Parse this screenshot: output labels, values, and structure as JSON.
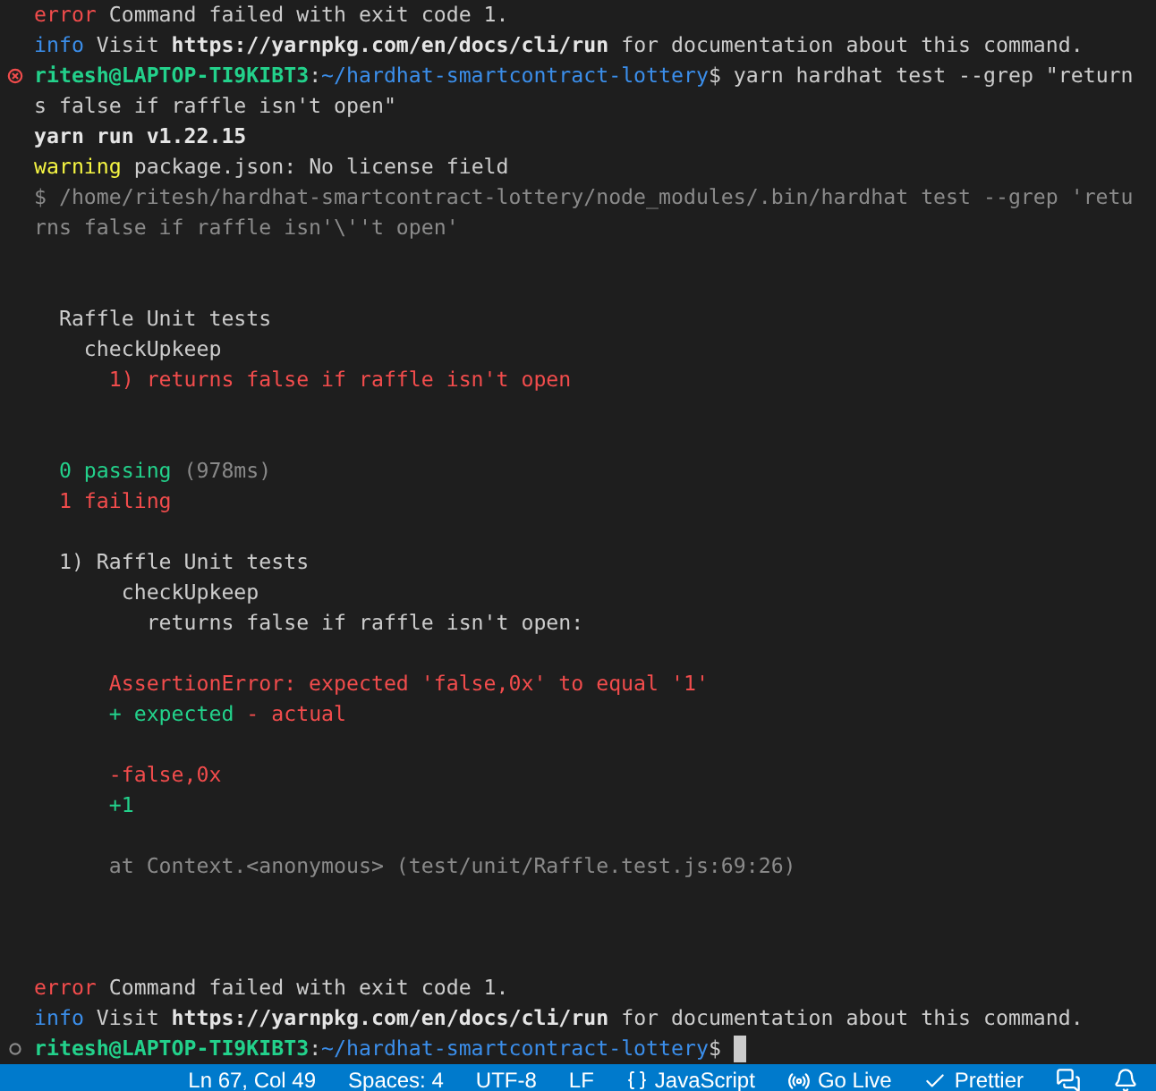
{
  "terminal": {
    "lines": [
      {
        "kind": "output",
        "segments": [
          {
            "kind": "error",
            "text": "error"
          },
          {
            "kind": "plain",
            "text": " Command failed with exit code 1."
          }
        ]
      },
      {
        "kind": "output",
        "segments": [
          {
            "kind": "info",
            "text": "info"
          },
          {
            "kind": "plain",
            "text": " Visit "
          },
          {
            "kind": "bold",
            "text": "https://yarnpkg.com/en/docs/cli/run"
          },
          {
            "kind": "plain",
            "text": " for documentation about this command."
          }
        ]
      },
      {
        "kind": "prompt",
        "failed": true,
        "cursor": false,
        "segments": [
          {
            "kind": "user",
            "text": "ritesh@LAPTOP-TI9KIBT3"
          },
          {
            "kind": "plain",
            "text": ":"
          },
          {
            "kind": "path",
            "text": "~/hardhat-smartcontract-lottery"
          },
          {
            "kind": "plain",
            "text": "$ yarn hardhat test --grep \"return"
          }
        ]
      },
      {
        "kind": "output",
        "segments": [
          {
            "kind": "plain",
            "text": "s false if raffle isn't open\""
          }
        ]
      },
      {
        "kind": "output",
        "segments": [
          {
            "kind": "bold",
            "text": "yarn run v1.22.15"
          }
        ]
      },
      {
        "kind": "output",
        "segments": [
          {
            "kind": "warning",
            "text": "warning"
          },
          {
            "kind": "plain",
            "text": " package.json: No license field"
          }
        ]
      },
      {
        "kind": "output",
        "segments": [
          {
            "kind": "dim",
            "text": "$ /home/ritesh/hardhat-smartcontract-lottery/node_modules/.bin/hardhat test --grep 'retu"
          }
        ]
      },
      {
        "kind": "output",
        "segments": [
          {
            "kind": "dim",
            "text": "rns false if raffle isn'\\''t open'"
          }
        ]
      },
      {
        "kind": "blank"
      },
      {
        "kind": "blank"
      },
      {
        "kind": "output",
        "segments": [
          {
            "kind": "plain",
            "text": "  Raffle Unit tests"
          }
        ]
      },
      {
        "kind": "output",
        "segments": [
          {
            "kind": "plain",
            "text": "    checkUpkeep"
          }
        ]
      },
      {
        "kind": "output",
        "segments": [
          {
            "kind": "red",
            "text": "      1) returns false if raffle isn't open"
          }
        ]
      },
      {
        "kind": "blank"
      },
      {
        "kind": "blank"
      },
      {
        "kind": "output",
        "segments": [
          {
            "kind": "green",
            "text": "  0 passing"
          },
          {
            "kind": "dim",
            "text": " (978ms)"
          }
        ]
      },
      {
        "kind": "output",
        "segments": [
          {
            "kind": "red",
            "text": "  1 failing"
          }
        ]
      },
      {
        "kind": "blank"
      },
      {
        "kind": "output",
        "segments": [
          {
            "kind": "plain",
            "text": "  1) Raffle Unit tests"
          }
        ]
      },
      {
        "kind": "output",
        "segments": [
          {
            "kind": "plain",
            "text": "       checkUpkeep"
          }
        ]
      },
      {
        "kind": "output",
        "segments": [
          {
            "kind": "plain",
            "text": "         returns false if raffle isn't open:"
          }
        ]
      },
      {
        "kind": "blank"
      },
      {
        "kind": "output",
        "segments": [
          {
            "kind": "red",
            "text": "      AssertionError: expected 'false,0x' to equal '1'"
          }
        ]
      },
      {
        "kind": "output",
        "segments": [
          {
            "kind": "green",
            "text": "      + expected "
          },
          {
            "kind": "red",
            "text": "- actual"
          }
        ]
      },
      {
        "kind": "blank"
      },
      {
        "kind": "output",
        "segments": [
          {
            "kind": "red",
            "text": "      -false,0x"
          }
        ]
      },
      {
        "kind": "output",
        "segments": [
          {
            "kind": "green",
            "text": "      +1"
          }
        ]
      },
      {
        "kind": "blank"
      },
      {
        "kind": "output",
        "segments": [
          {
            "kind": "dim",
            "text": "      at Context.<anonymous> (test/unit/Raffle.test.js:69:26)"
          }
        ]
      },
      {
        "kind": "blank"
      },
      {
        "kind": "blank"
      },
      {
        "kind": "blank"
      },
      {
        "kind": "output",
        "segments": [
          {
            "kind": "error",
            "text": "error"
          },
          {
            "kind": "plain",
            "text": " Command failed with exit code 1."
          }
        ]
      },
      {
        "kind": "output",
        "segments": [
          {
            "kind": "info",
            "text": "info"
          },
          {
            "kind": "plain",
            "text": " Visit "
          },
          {
            "kind": "bold",
            "text": "https://yarnpkg.com/en/docs/cli/run"
          },
          {
            "kind": "plain",
            "text": " for documentation about this command."
          }
        ]
      },
      {
        "kind": "prompt",
        "failed": false,
        "cursor": true,
        "segments": [
          {
            "kind": "user",
            "text": "ritesh@LAPTOP-TI9KIBT3"
          },
          {
            "kind": "plain",
            "text": ":"
          },
          {
            "kind": "path",
            "text": "~/hardhat-smartcontract-lottery"
          },
          {
            "kind": "plain",
            "text": "$ "
          }
        ]
      }
    ]
  },
  "status_bar": {
    "items": [
      {
        "kind": "text",
        "text": "Ln 67, Col 49"
      },
      {
        "kind": "text",
        "text": "Spaces: 4"
      },
      {
        "kind": "text",
        "text": "UTF-8"
      },
      {
        "kind": "text",
        "text": "LF"
      },
      {
        "kind": "language",
        "text": "JavaScript"
      },
      {
        "kind": "golive",
        "text": "Go Live"
      },
      {
        "kind": "prettier",
        "text": "Prettier"
      },
      {
        "kind": "feedback"
      },
      {
        "kind": "bell"
      }
    ]
  }
}
